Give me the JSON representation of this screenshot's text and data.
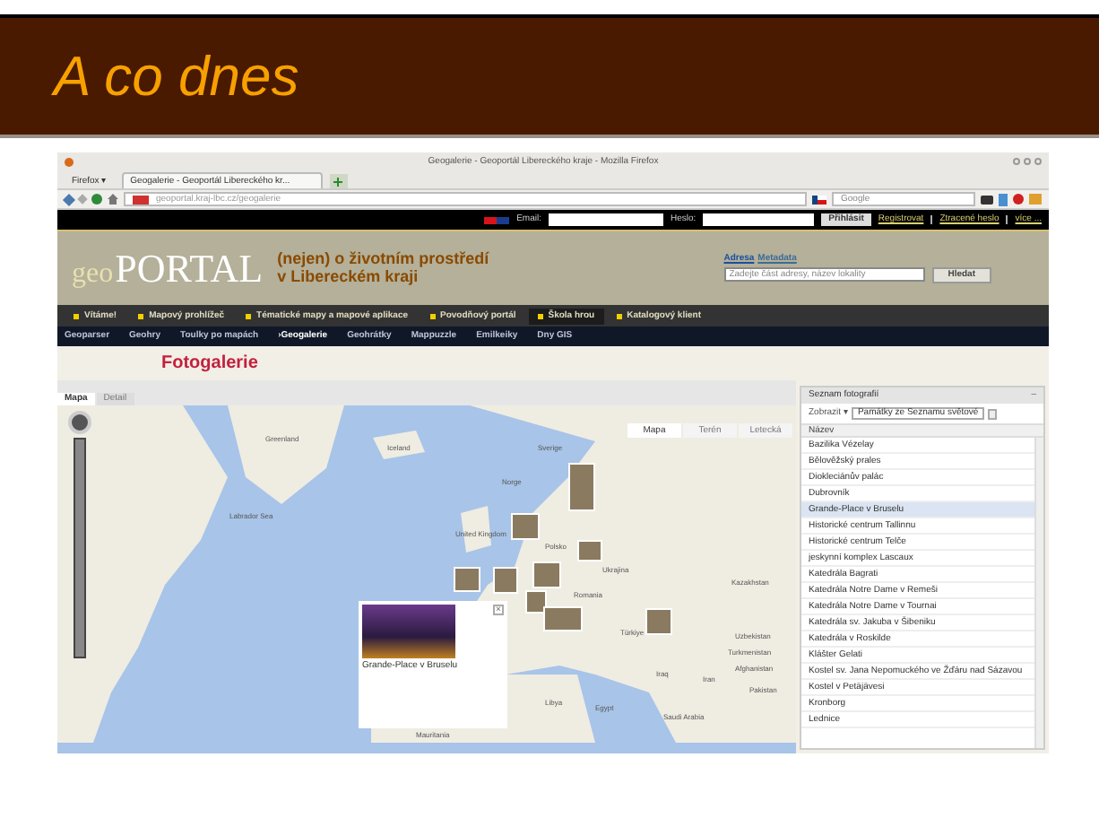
{
  "slide": {
    "title": "A co dnes"
  },
  "browser": {
    "window_title": "Geogalerie - Geoportál Libereckého kraje - Mozilla Firefox",
    "menu_button": "Firefox ▾",
    "tabs": [
      {
        "label": "Geogalerie - Geoportál Libereckého kr...",
        "selected": true
      }
    ],
    "url": "geoportal.kraj-lbc.cz/geogalerie",
    "search_placeholder": "Google"
  },
  "login_bar": {
    "email_label": "Email:",
    "password_label": "Heslo:",
    "login_button": "Přihlásit",
    "links": [
      "Registrovat",
      "Ztracené heslo",
      "více ..."
    ]
  },
  "header": {
    "logo_small": "geo",
    "logo_big": "PORTAL",
    "tagline": [
      "(nejen) o životním prostředí",
      "v Libereckém kraji"
    ],
    "search_tabs": [
      {
        "label": "Adresa",
        "selected": true
      },
      {
        "label": "Metadata",
        "selected": false
      }
    ],
    "search_placeholder": "Zadejte část adresy, název lokality",
    "search_button": "Hledat"
  },
  "main_menu": [
    {
      "label": "Vítáme!",
      "selected": false
    },
    {
      "label": "Mapový prohlížeč",
      "selected": false
    },
    {
      "label": "Tématické mapy a mapové aplikace",
      "selected": false
    },
    {
      "label": "Povodňový portál",
      "selected": false
    },
    {
      "label": "Škola hrou",
      "selected": true
    },
    {
      "label": "Katalogový klient",
      "selected": false
    }
  ],
  "sub_menu": [
    {
      "label": "Geoparser",
      "selected": false
    },
    {
      "label": "Geohry",
      "selected": false
    },
    {
      "label": "Toulky po mapách",
      "selected": false
    },
    {
      "label": "›Geogalerie",
      "selected": true
    },
    {
      "label": "Geohrátky",
      "selected": false
    },
    {
      "label": "Mappuzzle",
      "selected": false
    },
    {
      "label": "Emilkeiky",
      "selected": false
    },
    {
      "label": "Dny GIS",
      "selected": false
    }
  ],
  "page_title": "Fotogalerie",
  "view_tabs": [
    {
      "label": "Mapa",
      "selected": true
    },
    {
      "label": "Detail",
      "selected": false
    }
  ],
  "map": {
    "type_buttons": [
      {
        "label": "Mapa",
        "selected": true
      },
      {
        "label": "Terén",
        "selected": false
      },
      {
        "label": "Letecká",
        "selected": false
      }
    ],
    "labels": [
      "Greenland",
      "Iceland",
      "Labrador Sea",
      "Sverige",
      "Norge",
      "United Kingdom",
      "Polsko",
      "Ukrajina",
      "Kazakhstan",
      "Romania",
      "Türkiye",
      "Uzbekistan",
      "Turkmenistan",
      "Afghanistan",
      "Iraq",
      "Iran",
      "Pakistan",
      "Libya",
      "Egypt",
      "Saudi Arabia",
      "Mauritania"
    ],
    "popup": {
      "caption": "Grande-Place v Bruselu",
      "close": "×"
    }
  },
  "photo_list": {
    "title": "Seznam fotografií",
    "collapse": "–",
    "show_label": "Zobrazit ▾",
    "filter": "Památky ze Seznamu světové",
    "column": "Název",
    "rows": [
      {
        "name": "Bazilika Vézelay",
        "selected": false
      },
      {
        "name": "Bělověžský prales",
        "selected": false
      },
      {
        "name": "Diokleciánův palác",
        "selected": false
      },
      {
        "name": "Dubrovník",
        "selected": false
      },
      {
        "name": "Grande-Place v Bruselu",
        "selected": true
      },
      {
        "name": "Historické centrum Tallinnu",
        "selected": false
      },
      {
        "name": "Historické centrum Telče",
        "selected": false
      },
      {
        "name": "jeskynní komplex Lascaux",
        "selected": false
      },
      {
        "name": "Katedrála Bagrati",
        "selected": false
      },
      {
        "name": "Katedrála Notre Dame v Remeši",
        "selected": false
      },
      {
        "name": "Katedrála Notre Dame v Tournai",
        "selected": false
      },
      {
        "name": "Katedrála sv. Jakuba v Šibeniku",
        "selected": false
      },
      {
        "name": "Katedrála v Roskilde",
        "selected": false
      },
      {
        "name": "Klášter Gelati",
        "selected": false
      },
      {
        "name": "Kostel sv. Jana Nepomuckého ve Žďáru nad Sázavou",
        "selected": false
      },
      {
        "name": "Kostel v Petäjävesi",
        "selected": false
      },
      {
        "name": "Kronborg",
        "selected": false
      },
      {
        "name": "Lednice",
        "selected": false
      }
    ]
  }
}
